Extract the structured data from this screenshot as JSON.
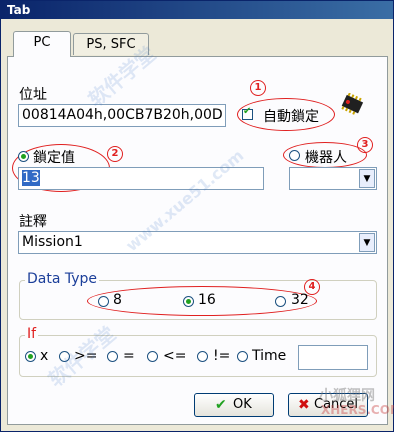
{
  "window": {
    "title": "Tab"
  },
  "tabs": [
    {
      "label": "PC",
      "active": true
    },
    {
      "label": "PS, SFC",
      "active": false
    }
  ],
  "address": {
    "label": "位址",
    "value": "00814A04h,00CB7B20h,00D"
  },
  "auto_lock": {
    "label": "自動鎖定",
    "checked": true
  },
  "lock_value": {
    "label": "鎖定值",
    "value": "13",
    "selected": true
  },
  "robot": {
    "label": "機器人",
    "selected": false,
    "value": ""
  },
  "comment": {
    "label": "註釋",
    "value": "Mission1"
  },
  "data_type": {
    "label": "Data Type",
    "options": [
      "8",
      "16",
      "32"
    ],
    "selected": "16"
  },
  "if_group": {
    "label": "If",
    "options": [
      "x",
      ">=",
      "=",
      "<=",
      "!=",
      "Time"
    ],
    "selected": "x",
    "value": ""
  },
  "buttons": {
    "ok": "OK",
    "cancel": "Cancel"
  },
  "annotations": {
    "n1": "1",
    "n2": "2",
    "n3": "3",
    "n4": "4"
  },
  "watermarks": {
    "w1": "软件学堂",
    "w2": "www.xue51.com",
    "w3": "小狐狸网",
    "w4": "XHERS.COM"
  },
  "colors": {
    "annotation_red": "#e02020",
    "title_blue": "#0a246a",
    "data_type_blue": "#1c3f9a"
  }
}
